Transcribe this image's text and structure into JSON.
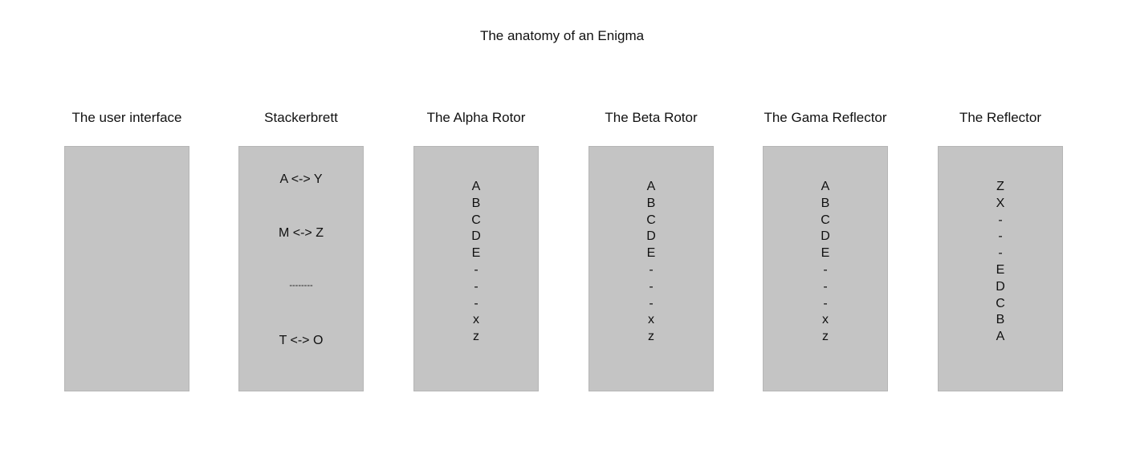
{
  "title": "The anatomy of an Enigma",
  "columns": [
    {
      "title": "The user interface"
    },
    {
      "title": "Stackerbrett",
      "pairs": [
        "A <-> Y",
        "M <-> Z",
        "--------",
        "T <-> O"
      ]
    },
    {
      "title": "The Alpha Rotor",
      "letters": [
        "A",
        "B",
        "C",
        "D",
        "E",
        "-",
        "-",
        "-",
        "x",
        "z"
      ]
    },
    {
      "title": "The Beta Rotor",
      "letters": [
        "A",
        "B",
        "C",
        "D",
        "E",
        "-",
        "-",
        "-",
        "x",
        "z"
      ]
    },
    {
      "title": "The Gama Reflector",
      "letters": [
        "A",
        "B",
        "C",
        "D",
        "E",
        "-",
        "-",
        "-",
        "x",
        "z"
      ]
    },
    {
      "title": "The Reflector",
      "letters": [
        "Z",
        "X",
        "-",
        "-",
        "-",
        "E",
        "D",
        "C",
        "B",
        "A"
      ]
    }
  ]
}
